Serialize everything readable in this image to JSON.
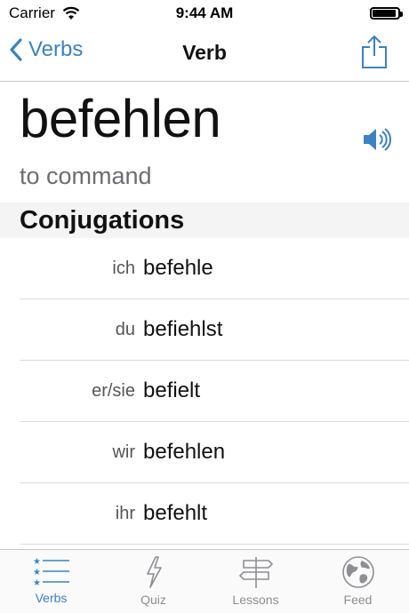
{
  "status": {
    "carrier": "Carrier",
    "time": "9:44 AM",
    "battery_level": 1.0
  },
  "nav": {
    "back_label": "Verbs",
    "title": "Verb"
  },
  "verb": {
    "infinitive": "befehlen",
    "translation": "to command"
  },
  "section": {
    "title": "Conjugations"
  },
  "conjugations": [
    {
      "pronoun": "ich",
      "form": "befehle"
    },
    {
      "pronoun": "du",
      "form": "befiehlst"
    },
    {
      "pronoun": "er/sie",
      "form": "befielt"
    },
    {
      "pronoun": "wir",
      "form": "befehlen"
    },
    {
      "pronoun": "ihr",
      "form": "befehlt"
    }
  ],
  "tabs": [
    {
      "label": "Verbs",
      "icon": "starred-list-icon",
      "active": true
    },
    {
      "label": "Quiz",
      "icon": "lightning-icon",
      "active": false
    },
    {
      "label": "Lessons",
      "icon": "signpost-icon",
      "active": false
    },
    {
      "label": "Feed",
      "icon": "globe-icon",
      "active": false
    }
  ],
  "colors": {
    "accent": "#3b82c4",
    "inactive": "#8e8e93"
  }
}
